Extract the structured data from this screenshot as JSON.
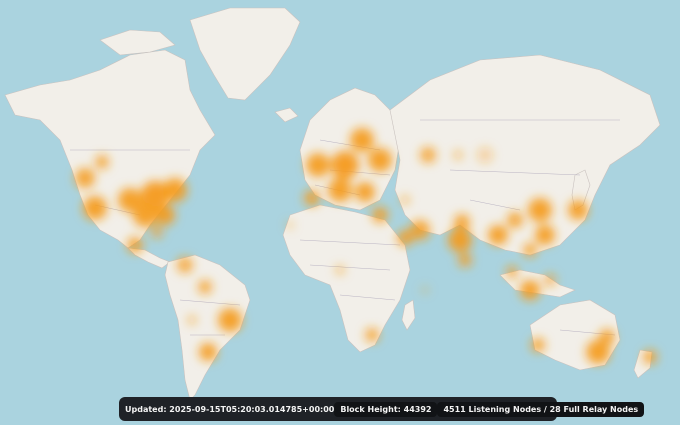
{
  "status": {
    "updated": "Updated: 2025-09-15T05:20:03.014785+00:00",
    "block_height": "Block Height: 44392",
    "nodes": "4511 Listening Nodes / 28 Full Relay Nodes"
  },
  "colors": {
    "ocean": "#aad3df",
    "land": "#f2efe9",
    "heat": "#f59a1a",
    "bar": "#1f2227"
  }
}
